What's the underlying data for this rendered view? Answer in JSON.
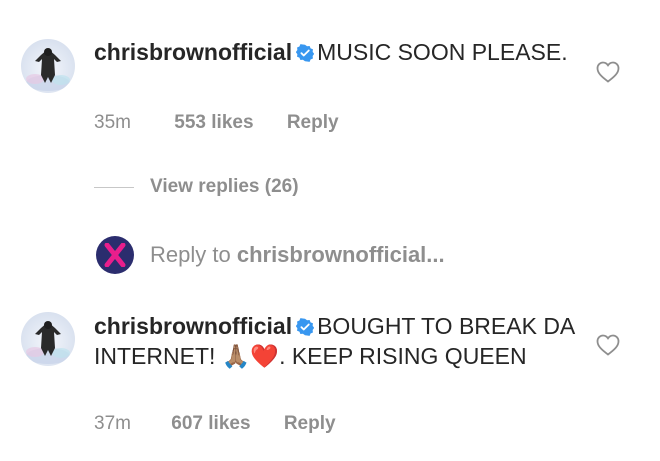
{
  "comments": [
    {
      "username": "chrisbrownofficial",
      "text": "MUSIC SOON PLEASE.",
      "time": "35m",
      "likes": "553 likes",
      "reply": "Reply"
    },
    {
      "username": "chrisbrownofficial",
      "text_before": "BOUGHT TO BREAK DA INTERNET! ",
      "emoji_pray": "🙏🏽",
      "emoji_heart": "❤️",
      "text_after": ". KEEP RISING QUEEN",
      "time": "37m",
      "likes": "607 likes",
      "reply": "Reply"
    }
  ],
  "view_replies": "View replies (26)",
  "reply_prompt": {
    "prefix": "Reply to ",
    "target": "chrisbrownofficial..."
  },
  "colors": {
    "text": "#262626",
    "secondary": "#8e8e8e",
    "verified": "#3897f0",
    "x_avatar_bg": "#2b2d6e",
    "x_mark": "#e91e8c"
  },
  "icons": [
    "avatar",
    "verified-badge-icon",
    "heart-icon",
    "x-logo-icon"
  ]
}
